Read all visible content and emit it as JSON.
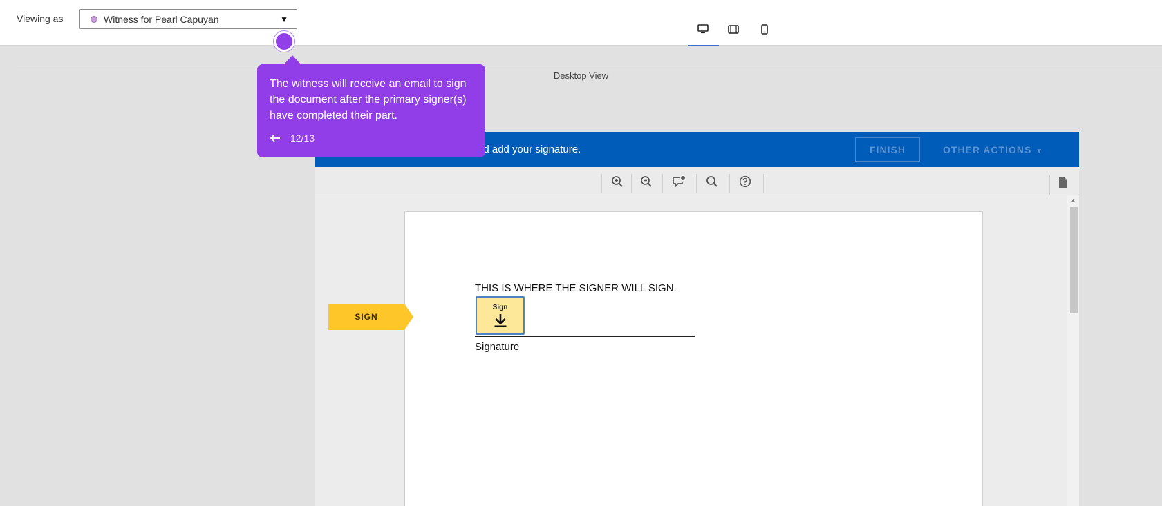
{
  "topbar": {
    "viewing_as_label": "Viewing as",
    "viewer": {
      "selected": "Witness for Pearl Capuyan",
      "dot_color": "#c79bd8"
    },
    "devices": [
      {
        "name": "desktop-view-icon",
        "active": true
      },
      {
        "name": "tablet-view-icon",
        "active": false
      },
      {
        "name": "mobile-view-icon",
        "active": false
      }
    ],
    "accent_color": "#3a6fd8"
  },
  "preview": {
    "label": "Desktop View"
  },
  "signing_app": {
    "header_color": "#005cb9",
    "header_message": "nd add your signature.",
    "finish_label": "FINISH",
    "other_actions_label": "OTHER ACTIONS",
    "toolbar_icons": [
      "zoom-in-icon",
      "zoom-out-icon",
      "comment-add-icon",
      "search-icon",
      "help-icon",
      "document-icon"
    ],
    "document": {
      "instruction_text": "THIS IS WHERE THE SIGNER WILL SIGN.",
      "sign_field_label": "Sign",
      "signature_caption": "Signature",
      "sign_tab_label": "SIGN",
      "sign_tab_color": "#ffc629"
    }
  },
  "guide": {
    "text": "The witness will receive an email to sign the document after the primary signer(s) have completed their part.",
    "step": "12/13",
    "color": "#923ee8"
  }
}
